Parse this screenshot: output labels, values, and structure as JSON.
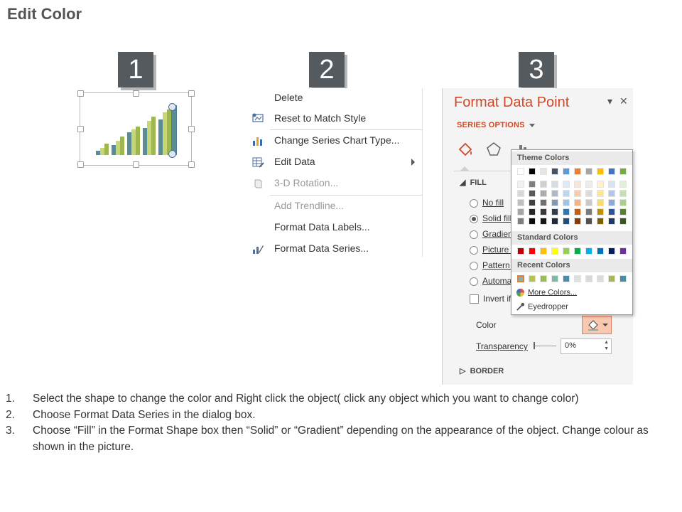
{
  "page_title": "Edit Color",
  "steps": [
    "1",
    "2",
    "3"
  ],
  "context_menu": {
    "items": [
      {
        "label": "Delete",
        "icon": "none",
        "disabled": false
      },
      {
        "label": "Reset to Match Style",
        "icon": "reset-style-icon",
        "disabled": false
      },
      {
        "label": "Change Series Chart Type...",
        "icon": "chart-type-icon",
        "disabled": false
      },
      {
        "label": "Edit Data",
        "icon": "edit-data-icon",
        "disabled": false,
        "submenu": true
      },
      {
        "label": "3-D Rotation...",
        "icon": "rotation-3d-icon",
        "disabled": true
      },
      {
        "label": "Add Trendline...",
        "icon": "none",
        "disabled": true
      },
      {
        "label": "Format Data Labels...",
        "icon": "none",
        "disabled": false
      },
      {
        "label": "Format Data Series...",
        "icon": "format-series-icon",
        "disabled": false
      }
    ]
  },
  "format_panel": {
    "title": "Format Data Point",
    "series_options": "SERIES OPTIONS",
    "fill_section": "FILL",
    "fill_options": [
      {
        "label": "No fill",
        "selected": false
      },
      {
        "label": "Solid fill",
        "selected": true
      },
      {
        "label": "Gradient",
        "selected": false
      },
      {
        "label": "Picture o",
        "selected": false
      },
      {
        "label": "Pattern f",
        "selected": false
      },
      {
        "label": "Automa",
        "selected": false
      }
    ],
    "invert_label": "Invert if",
    "color_label": "Color",
    "transparency_label": "Transparency",
    "transparency_value": "0%",
    "border_section": "BORDER"
  },
  "color_palette": {
    "theme_header": "Theme Colors",
    "standard_header": "Standard Colors",
    "recent_header": "Recent Colors",
    "more_colors": "More Colors...",
    "eyedropper": "Eyedropper",
    "theme_top": [
      "#ffffff",
      "#000000",
      "#e7e6e6",
      "#44546a",
      "#5b9bd5",
      "#ed7d31",
      "#a5a5a5",
      "#ffc000",
      "#4472c4",
      "#70ad47"
    ],
    "theme_shades": [
      [
        "#f2f2f2",
        "#7f7f7f",
        "#d0cece",
        "#d6dce4",
        "#deebf6",
        "#fbe5d5",
        "#ededed",
        "#fff2cc",
        "#dae3f3",
        "#e2efd9"
      ],
      [
        "#d8d8d8",
        "#595959",
        "#aeabab",
        "#adb9ca",
        "#bdd7ee",
        "#f7cbac",
        "#dbdbdb",
        "#ffe598",
        "#b4c6e7",
        "#c5e0b3"
      ],
      [
        "#bfbfbf",
        "#3f3f3f",
        "#757070",
        "#8496b0",
        "#9dc3e6",
        "#f4b183",
        "#c9c9c9",
        "#ffd966",
        "#8eaadb",
        "#a8d08d"
      ],
      [
        "#a5a5a5",
        "#262626",
        "#3a3838",
        "#323f4f",
        "#2e75b5",
        "#c55a11",
        "#7b7b7b",
        "#bf9000",
        "#2f5496",
        "#538135"
      ],
      [
        "#7f7f7f",
        "#0c0c0c",
        "#171616",
        "#222a35",
        "#1e4e79",
        "#833c0b",
        "#525252",
        "#7f6000",
        "#1f3864",
        "#375623"
      ]
    ],
    "standard": [
      "#c00000",
      "#ff0000",
      "#ffc000",
      "#ffff00",
      "#92d050",
      "#00b050",
      "#00b0f0",
      "#0070c0",
      "#002060",
      "#7030a0"
    ],
    "recent": [
      "#8fb0a0",
      "#b7c15a",
      "#9bbb59",
      "#7fb8a8",
      "#4a8aa8",
      "#e0e0e0",
      "#d8d8d8",
      "#dcdcdc",
      "#a7b55b",
      "#4c8aa0"
    ]
  },
  "chart_colors": {
    "light": "#c6d676",
    "mid": "#9cb84c",
    "teal": "#5a8c96"
  },
  "instructions": [
    {
      "num": "1.",
      "text": "Select the shape to change the color and Right click the object( click any object which you want to change color)"
    },
    {
      "num": "2.",
      "text": "Choose Format Data Series in the dialog box."
    },
    {
      "num": "3.",
      "text": "Choose “Fill” in the Format Shape box then “Solid” or “Gradient” depending on the appearance of the object. Change colour as shown in the picture."
    }
  ]
}
